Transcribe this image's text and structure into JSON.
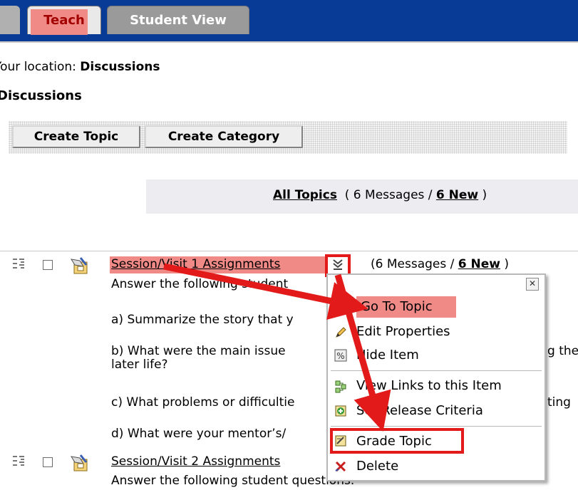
{
  "tabs": {
    "teach": "Teach",
    "student_view": "Student View"
  },
  "location": {
    "prefix": "Your location:",
    "current": "Discussions"
  },
  "page_title": "Discussions",
  "buttons": {
    "create_topic": "Create Topic",
    "create_category": "Create Category"
  },
  "summary": {
    "all_topics": "All Topics",
    "open": "( 6 Messages / ",
    "new": "6 New",
    "close": " )"
  },
  "topics": [
    {
      "title": "Session/Visit 1 Assignments",
      "counts_open": "(6 Messages / ",
      "counts_new": "6 New",
      "counts_close": " )",
      "intro_visible": "Answer the fo",
      "intro_partial": "llowing student",
      "lines": [
        "a) Summarize the story that y",
        "b) What were the main issue",
        "later life?",
        "c) What problems or difficultie",
        "d) What were your mentor’s/"
      ],
      "right_fragments": [
        "g the",
        "ting"
      ]
    },
    {
      "title": "Session/Visit 2 Assignments",
      "intro": "Answer the following student questions."
    }
  ],
  "context_menu": {
    "close": "✕",
    "items": [
      {
        "label": "Go To Topic",
        "icon": ""
      },
      {
        "label": "Edit Properties",
        "icon": "pencil-icon"
      },
      {
        "label": "Hide Item",
        "icon": "hide-icon"
      },
      {
        "label": "View Links to this Item",
        "icon": "links-icon"
      },
      {
        "label": "Set Release Criteria",
        "icon": "release-criteria-icon"
      },
      {
        "label": "Grade Topic",
        "icon": "grade-icon"
      },
      {
        "label": "Delete",
        "icon": "delete-icon"
      }
    ]
  },
  "annotation_color": "#e21a1a",
  "highlight_color": "#f08a86"
}
